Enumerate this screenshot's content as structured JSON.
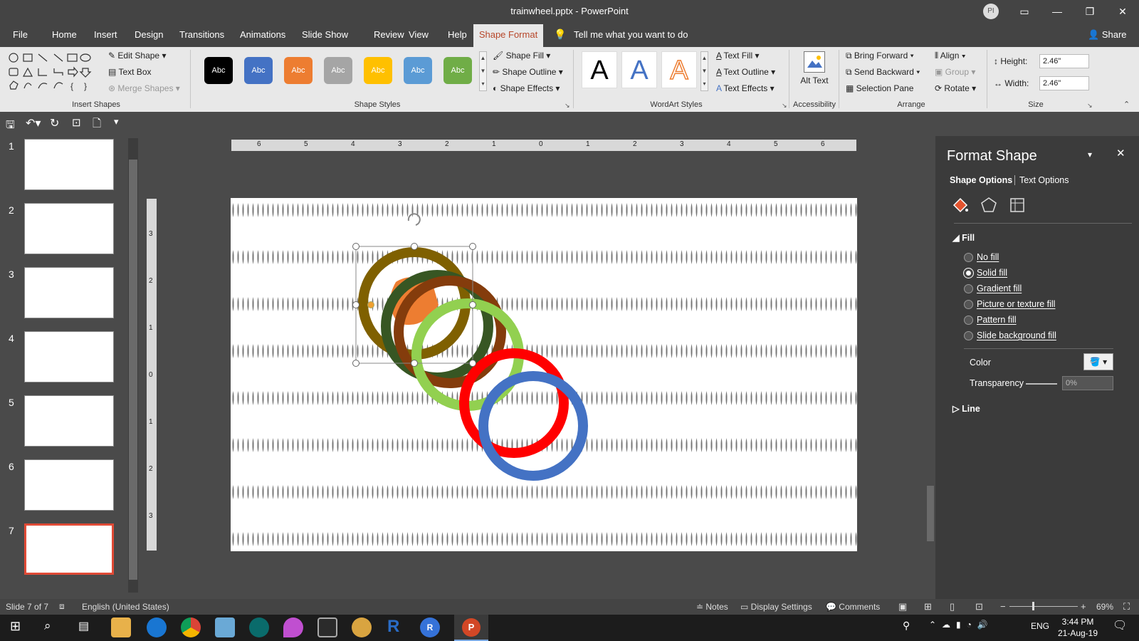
{
  "window": {
    "title": "trainwheel.pptx  -  PowerPoint",
    "avatar": "PI",
    "share": "Share"
  },
  "menu": {
    "tabs": [
      "File",
      "Home",
      "Insert",
      "Design",
      "Transitions",
      "Animations",
      "Slide Show",
      "Review",
      "View",
      "Help"
    ],
    "active_tab": "Shape Format",
    "tell_me": "Tell me what you want to do"
  },
  "ribbon": {
    "insert_shapes": {
      "edit_shape": "Edit Shape",
      "text_box": "Text Box",
      "merge_shapes": "Merge Shapes",
      "group_label": "Insert Shapes"
    },
    "shape_styles": {
      "samples": [
        "Abc",
        "Abc",
        "Abc",
        "Abc",
        "Abc",
        "Abc",
        "Abc"
      ],
      "colors": [
        "#000000",
        "#4472c4",
        "#ed7d31",
        "#a5a5a5",
        "#ffc000",
        "#5b9bd5",
        "#70ad47"
      ],
      "shape_fill": "Shape Fill",
      "shape_outline": "Shape Outline",
      "shape_effects": "Shape Effects",
      "group_label": "Shape Styles"
    },
    "wordart": {
      "samples": [
        "A",
        "A",
        "A"
      ],
      "text_fill": "Text Fill",
      "text_outline": "Text Outline",
      "text_effects": "Text Effects",
      "group_label": "WordArt Styles"
    },
    "accessibility": {
      "alt_text": "Alt Text",
      "group_label": "Accessibility"
    },
    "arrange": {
      "bring_forward": "Bring Forward",
      "send_backward": "Send Backward",
      "selection_pane": "Selection Pane",
      "align": "Align",
      "group": "Group",
      "rotate": "Rotate",
      "group_label": "Arrange"
    },
    "size": {
      "height_label": "Height:",
      "height_value": "2.46\"",
      "width_label": "Width:",
      "width_value": "2.46\"",
      "group_label": "Size"
    }
  },
  "thumbnails": {
    "numbers": [
      "1",
      "2",
      "3",
      "4",
      "5",
      "6",
      "7"
    ],
    "active": 7
  },
  "slide": {
    "ruler_h": [
      "6",
      "5",
      "4",
      "3",
      "2",
      "1",
      "0",
      "1",
      "2",
      "3",
      "4",
      "5",
      "6"
    ],
    "ruler_v": [
      "3",
      "2",
      "1",
      "0",
      "1",
      "2",
      "3"
    ],
    "rings": [
      {
        "color": "#7f6000"
      },
      {
        "color": "#375623"
      },
      {
        "color": "#843c0c"
      },
      {
        "color": "#92d050"
      },
      {
        "color": "#ff0000"
      },
      {
        "color": "#4472c4"
      }
    ],
    "orange_shape_color": "#ed7d31"
  },
  "format_pane": {
    "title": "Format Shape",
    "tab_shape": "Shape Options",
    "tab_text": "Text Options",
    "fill_header": "Fill",
    "fill_options": [
      "No fill",
      "Solid fill",
      "Gradient fill",
      "Picture or texture fill",
      "Pattern fill",
      "Slide background fill"
    ],
    "selected_fill": "Solid fill",
    "color_label": "Color",
    "transparency_label": "Transparency",
    "transparency_value": "0%",
    "line_header": "Line"
  },
  "status": {
    "slide_info": "Slide 7 of 7",
    "language": "English (United States)",
    "notes": "Notes",
    "display_settings": "Display Settings",
    "comments": "Comments",
    "zoom": "69%"
  },
  "taskbar": {
    "lang": "ENG",
    "time": "3:44 PM",
    "date": "21-Aug-19"
  }
}
